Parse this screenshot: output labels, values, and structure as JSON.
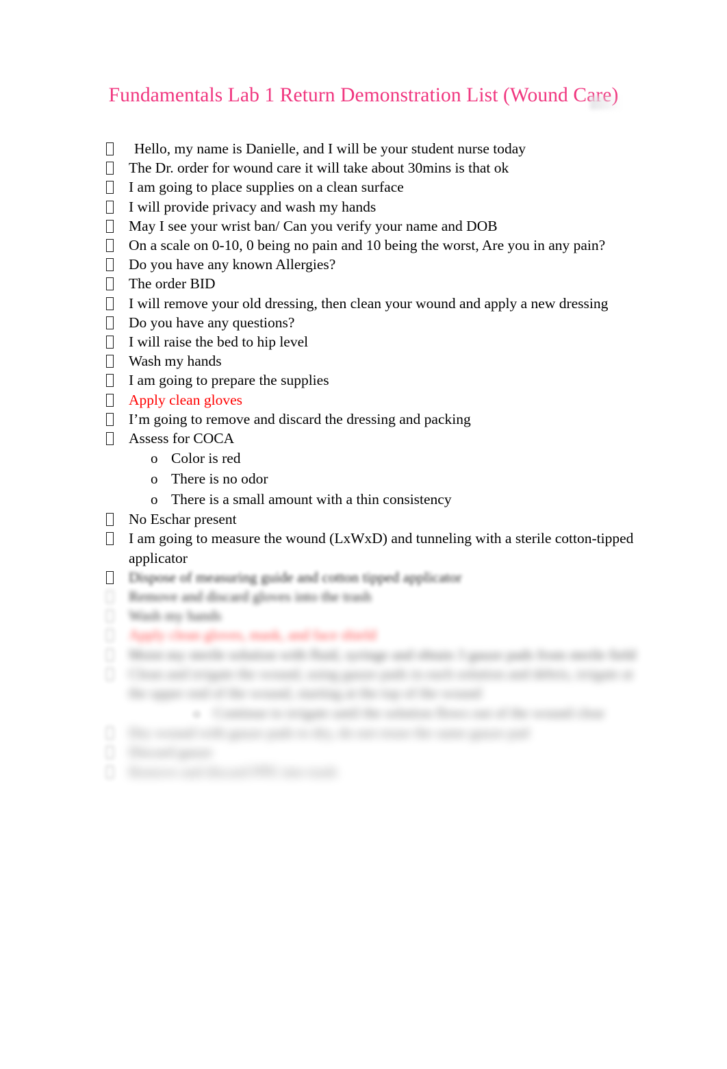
{
  "document": {
    "title": "Fundamentals Lab 1 Return Demonstration List (Wound Care)",
    "title_color": "#f0367f",
    "body_text_color": "#000000",
    "accent_red": "#ff0000",
    "background": "#ffffff",
    "bullet_glyph": "missing-glyph-box",
    "sub_bullet_glyph": "o"
  },
  "list": {
    "items": [
      {
        "text": "Hello, my name is Danielle, and I will be your student nurse today",
        "color": "black",
        "blur": 0
      },
      {
        "text": "The Dr. order for wound care it will take about 30mins is that ok",
        "color": "black",
        "blur": 0
      },
      {
        "text": "I am going to place supplies on a clean surface",
        "color": "black",
        "blur": 0
      },
      {
        "text": "I will provide privacy and wash my hands",
        "color": "black",
        "blur": 0
      },
      {
        "text": "May I see your wrist ban/ Can you verify your name and DOB",
        "color": "black",
        "blur": 0
      },
      {
        "text": "On a scale on 0-10, 0 being no pain and 10 being the worst, Are you in any pain?",
        "color": "black",
        "blur": 0
      },
      {
        "text": "Do you have any known Allergies?",
        "color": "black",
        "blur": 0
      },
      {
        "text": "The order BID",
        "color": "black",
        "blur": 0
      },
      {
        "text": "I will remove your old dressing, then clean your wound and apply a new dressing",
        "color": "black",
        "blur": 0
      },
      {
        "text": "Do you have any questions?",
        "color": "black",
        "blur": 0
      },
      {
        "text": "I will raise the bed to hip level",
        "color": "black",
        "blur": 0
      },
      {
        "text": "Wash my hands",
        "color": "black",
        "blur": 0
      },
      {
        "text": "I am going to prepare the supplies",
        "color": "black",
        "blur": 0
      },
      {
        "text": "Apply clean gloves",
        "color": "red",
        "blur": 0
      },
      {
        "text": "I’m going to remove and discard the dressing and packing",
        "color": "black",
        "blur": 0
      },
      {
        "text": "Assess for COCA",
        "color": "black",
        "blur": 0
      },
      {
        "text": "Color is red",
        "color": "black",
        "blur": 0,
        "level": 2
      },
      {
        "text": "There is no odor",
        "color": "black",
        "blur": 0,
        "level": 2
      },
      {
        "text": "There is a small amount with a thin consistency",
        "color": "black",
        "blur": 0,
        "level": 2
      },
      {
        "text": "No Eschar present",
        "color": "black",
        "blur": 0
      },
      {
        "text": "I am going to measure the wound (LxWxD) and tunneling with a sterile cotton-tipped applicator",
        "color": "black",
        "blur": 0
      }
    ],
    "obscured_items": [
      {
        "text": "Dispose of measuring guide and cotton tipped applicator",
        "color": "black",
        "blur": 1
      },
      {
        "text": "Remove and discard gloves into the trash",
        "color": "black",
        "blur": 2
      },
      {
        "text": "Wash my hands",
        "color": "black",
        "blur": 3
      },
      {
        "text": "Apply clean gloves, mask, and face shield",
        "color": "red",
        "blur": 4
      },
      {
        "text": "Moist my sterile solution with fluid, syringe and obtain 3 gauze pads from sterile field",
        "color": "black",
        "blur": 5
      },
      {
        "text": "Clean and irrigate the wound, using gauze pads in each solution and debris, irrigate at the upper end of the wound, starting at the top of the wound",
        "color": "black",
        "blur": 6
      },
      {
        "text": "Continue to irrigate until the solution flows out of the wound clear",
        "color": "black",
        "blur": 6,
        "level": 2
      },
      {
        "text": "Dry wound with gauze pads to dry, do not reuse the same gauze pad",
        "color": "black",
        "blur": 7
      },
      {
        "text": "Discard gauze",
        "color": "black",
        "blur": 7
      },
      {
        "text": "Remove and discard PPE into trash",
        "color": "black",
        "blur": 8
      }
    ]
  }
}
